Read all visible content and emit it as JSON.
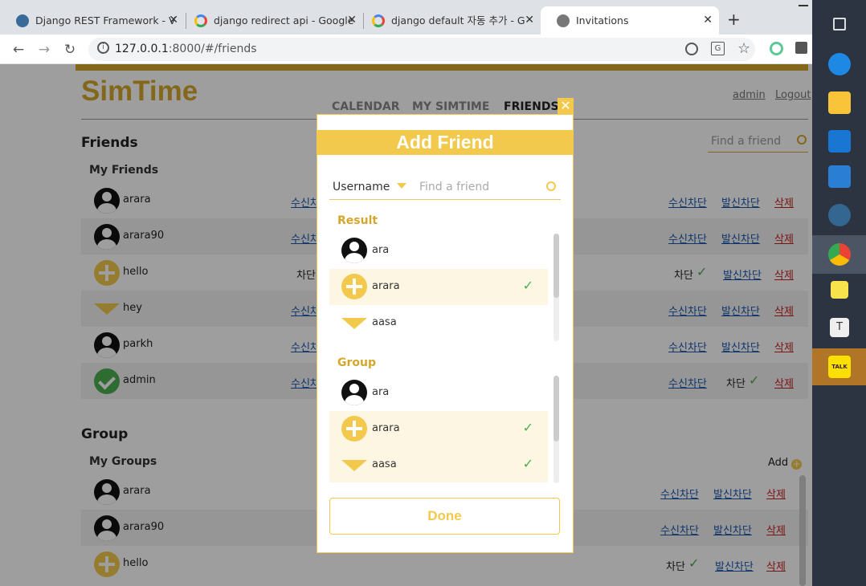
{
  "browser": {
    "tabs": [
      {
        "title": "Django REST Framework - V",
        "favicon": "django-icon"
      },
      {
        "title": "django redirect api - Google",
        "favicon": "google-icon"
      },
      {
        "title": "django default 자동 추가 - G",
        "favicon": "google-icon"
      },
      {
        "title": "Invitations",
        "favicon": "globe-icon"
      }
    ],
    "url_host": "127.0.0.1",
    "url_path": ":8000/#/friends"
  },
  "app": {
    "logo": "SimTime",
    "nav": {
      "calendar": "CALENDAR",
      "my_simtime": "MY SIMTIME",
      "friends": "FRIENDS"
    },
    "user": "admin",
    "logout": "Logout",
    "friends_title": "Friends",
    "find_placeholder": "Find a friend",
    "my_friends": "My Friends",
    "friends": [
      {
        "name": "arara",
        "icon": "avatar",
        "col": "수신차",
        "recv": "수신차단",
        "send": "발신차단",
        "del": "삭제",
        "blocked": ""
      },
      {
        "name": "arara90",
        "icon": "avatar",
        "col": "수신차",
        "recv": "수신차단",
        "send": "발신차단",
        "del": "삭제",
        "blocked": ""
      },
      {
        "name": "hello",
        "icon": "plus",
        "col": "차단",
        "recv": "차단",
        "send": "발신차단",
        "del": "삭제",
        "blocked": "recv"
      },
      {
        "name": "hey",
        "icon": "triangle",
        "col": "수신차",
        "recv": "수신차단",
        "send": "발신차단",
        "del": "삭제",
        "blocked": ""
      },
      {
        "name": "parkh",
        "icon": "avatar",
        "col": "수신차",
        "recv": "수신차단",
        "send": "발신차단",
        "del": "삭제",
        "blocked": ""
      },
      {
        "name": "admin",
        "icon": "check",
        "col": "수신차",
        "recv": "수신차단",
        "send": "차단",
        "del": "삭제",
        "blocked": "send"
      }
    ],
    "group_title": "Group",
    "my_groups": "My Groups",
    "add_label": "Add",
    "groups": [
      {
        "name": "arara",
        "icon": "avatar",
        "recv": "수신차단",
        "send": "발신차단",
        "del": "삭제",
        "blocked": ""
      },
      {
        "name": "arara90",
        "icon": "avatar",
        "recv": "수신차단",
        "send": "발신차단",
        "del": "삭제",
        "blocked": ""
      },
      {
        "name": "hello",
        "icon": "plus",
        "recv": "차단",
        "send": "발신차단",
        "del": "삭제",
        "blocked": "recv"
      }
    ]
  },
  "modal": {
    "title": "Add Friend",
    "search_type": "Username",
    "search_placeholder": "Find a friend",
    "result_title": "Result",
    "results": [
      {
        "name": "ara",
        "icon": "avatar",
        "checked": false
      },
      {
        "name": "arara",
        "icon": "plus",
        "checked": true
      },
      {
        "name": "aasa",
        "icon": "triangle",
        "checked": false
      }
    ],
    "group_title": "Group",
    "groups": [
      {
        "name": "ara",
        "icon": "avatar",
        "checked": false
      },
      {
        "name": "arara",
        "icon": "plus",
        "checked": true
      },
      {
        "name": "aasa",
        "icon": "triangle",
        "checked": true
      }
    ],
    "done_label": "Done"
  },
  "colors": {
    "accent": "#f2c94c",
    "logo": "#d4a72c",
    "link": "#1a56b0",
    "delete": "#c72020",
    "check": "#4caf50"
  }
}
